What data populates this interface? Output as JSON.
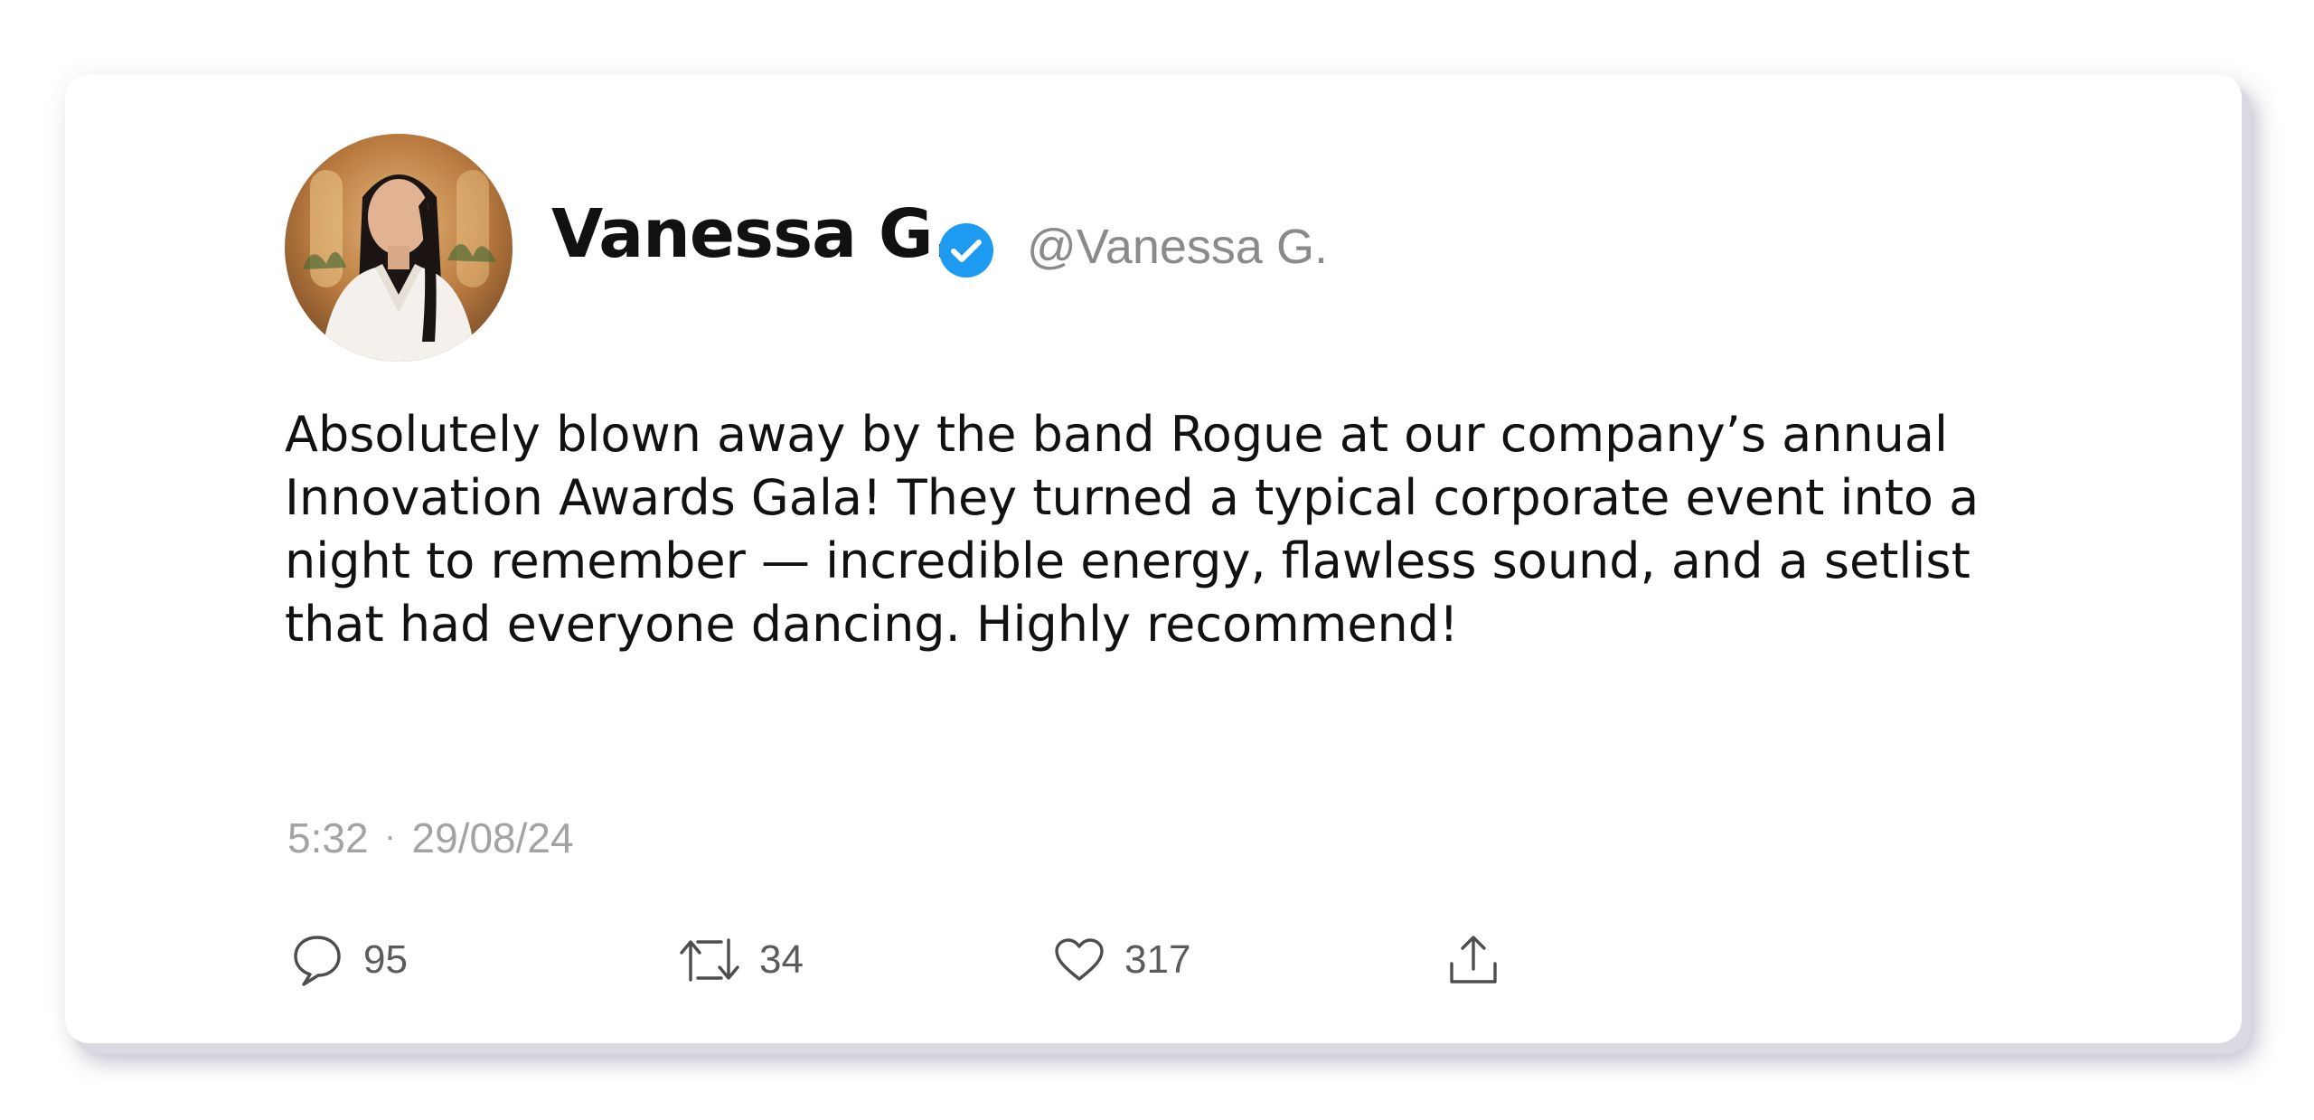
{
  "tweet": {
    "author": {
      "display_name": "Vanessa G.",
      "handle": "@Vanessa G.",
      "verified": true,
      "verified_color": "#1d9bf0"
    },
    "text": "Absolutely blown away by the band Rogue at our company’s annual Innovation Awards Gala! They turned a typical corporate event into a night to remember — incredible energy, flawless sound, and a setlist that had everyone dancing. Highly recommend!",
    "time": "5:32",
    "separator": "·",
    "date": "29/08/24",
    "actions": {
      "reply": {
        "icon": "speech-bubble-icon",
        "count": "95"
      },
      "retweet": {
        "icon": "retweet-icon",
        "count": "34"
      },
      "like": {
        "icon": "heart-icon",
        "count": "317"
      },
      "share": {
        "icon": "share-icon"
      }
    }
  }
}
